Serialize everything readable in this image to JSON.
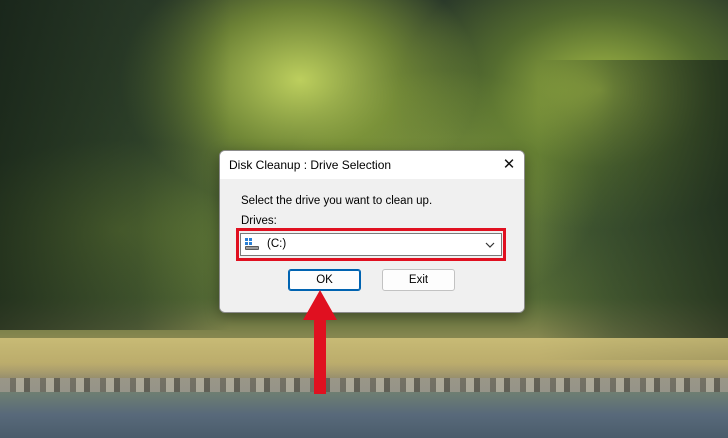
{
  "dialog": {
    "title": "Disk Cleanup : Drive Selection",
    "close_glyph": "✕",
    "prompt": "Select the drive you want to clean up.",
    "drives_label": "Drives:",
    "selected_drive": "(C:)",
    "ok_label": "OK",
    "exit_label": "Exit"
  },
  "icons": {
    "drive": "drive-icon",
    "dropdown": "chevron-down-icon",
    "close": "close-icon"
  },
  "colors": {
    "highlight": "#e01020",
    "default_button_border": "#0063b1",
    "annotation_arrow": "#e01020"
  }
}
